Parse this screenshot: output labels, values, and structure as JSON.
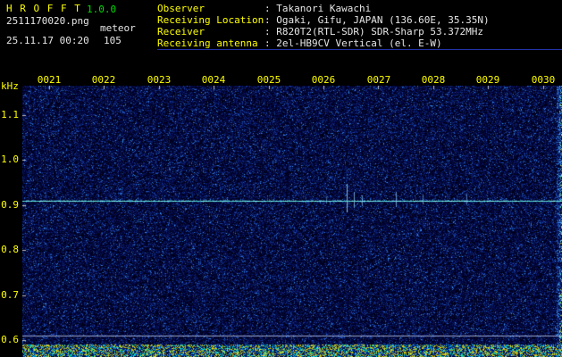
{
  "header": {
    "app_name": "H R O F F T",
    "version": "1.0.0",
    "filename": "2511170020.png",
    "mode_label": "meteor",
    "timestamp": "25.11.17 00:20",
    "count": "105",
    "info": [
      {
        "label": "Observer",
        "value": ": Takanori Kawachi"
      },
      {
        "label": "Receiving Location",
        "value": ": Ogaki, Gifu, JAPAN (136.60E, 35.35N)"
      },
      {
        "label": "Receiver",
        "value": ": R820T2(RTL-SDR) SDR-Sharp 53.372MHz"
      },
      {
        "label": "Receiving antenna",
        "value": ": 2el-HB9CV Vertical (el. E-W)"
      }
    ]
  },
  "chart_data": {
    "type": "heatmap",
    "title": "",
    "x_axis": {
      "label": "",
      "ticks": [
        "0021",
        "0022",
        "0023",
        "0024",
        "0025",
        "0026",
        "0027",
        "0028",
        "0029",
        "0030"
      ]
    },
    "y_axis": {
      "label": "kHz",
      "ticks": [
        "1.1",
        "1.0",
        "0.9",
        "0.8",
        "0.7",
        "0.6"
      ],
      "range_khz": [
        0.58,
        1.16
      ]
    },
    "carrier_line_khz": 0.91,
    "baseline_khz": 0.61,
    "observation_span_minutes": 10,
    "notable_echoes": [
      {
        "time": "0026",
        "freq_khz": 0.91
      },
      {
        "time": "0027",
        "freq_khz": 0.91
      }
    ],
    "background": "dark blue broadband noise field",
    "bottom_band": "signal-level strip of dense yellow/cyan/blue noise"
  },
  "colors": {
    "background": "#000000",
    "label_yellow": "#ffff00",
    "version_green": "#00dd00",
    "value_white": "#e6e6e6",
    "noise_blue": "#0018a0",
    "carrier_line_cyan": "#6fe0d8",
    "baseline_blue_white": "#aab9e1",
    "info_underline_blue": "#2233aa",
    "band_yellow": "#b4b400",
    "band_cyan": "#00b4c0"
  }
}
